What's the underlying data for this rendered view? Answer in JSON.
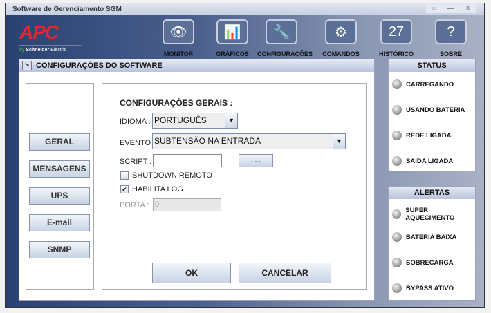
{
  "window": {
    "title": "Software de Gerenciamento SGM",
    "controls": [
      "○",
      "—",
      "X"
    ]
  },
  "logo": {
    "brand": "APC",
    "by": "by",
    "company": "Schneider",
    "sub": "Electric"
  },
  "toolbar": [
    {
      "label": "MONITOR",
      "icon": "eye-icon",
      "glyph": "👁"
    },
    {
      "label": "GRÁFICOS",
      "icon": "bar-chart-icon",
      "glyph": "📊"
    },
    {
      "label": "CONFIGURAÇÕES",
      "icon": "wrench-icon",
      "glyph": "🔧"
    },
    {
      "label": "COMANDOS",
      "icon": "gears-icon",
      "glyph": "⚙"
    },
    {
      "label": "HISTÓRICO",
      "icon": "calendar-icon",
      "glyph": "27"
    },
    {
      "label": "SOBRE",
      "icon": "question-icon",
      "glyph": "?"
    }
  ],
  "config": {
    "title": "CONFIGURAÇÕES DO SOFTWARE",
    "nav": [
      "GERAL",
      "MENSAGENS",
      "UPS",
      "E-mail",
      "SNMP"
    ],
    "section": "CONFIGURAÇÕES GERAIS :",
    "idioma_label": "IDIOMA :",
    "idioma_value": "PORTUGUÊS",
    "evento_label": "EVENTO :",
    "evento_value": "SUBTENSÃO NA ENTRADA",
    "script_label": "SCRIPT :",
    "script_value": "",
    "browse": ". . .",
    "shutdown_label": "SHUTDOWN REMOTO",
    "shutdown_checked": false,
    "log_label": "HABILITA LOG",
    "log_checked": true,
    "check_glyph": "✔",
    "porta_label": "PORTA :",
    "porta_value": "0",
    "ok": "OK",
    "cancel": "CANCELAR"
  },
  "status": {
    "title": "STATUS",
    "items": [
      "CARREGANDO",
      "USANDO BATERIA",
      "REDE LIGADA",
      "SAIDA LIGADA"
    ]
  },
  "alerts": {
    "title": "ALERTAS",
    "items": [
      "SUPER AQUECIMENTO",
      "BATERIA BAIXA",
      "SOBRECARGA",
      "BYPASS ATIVO"
    ]
  }
}
